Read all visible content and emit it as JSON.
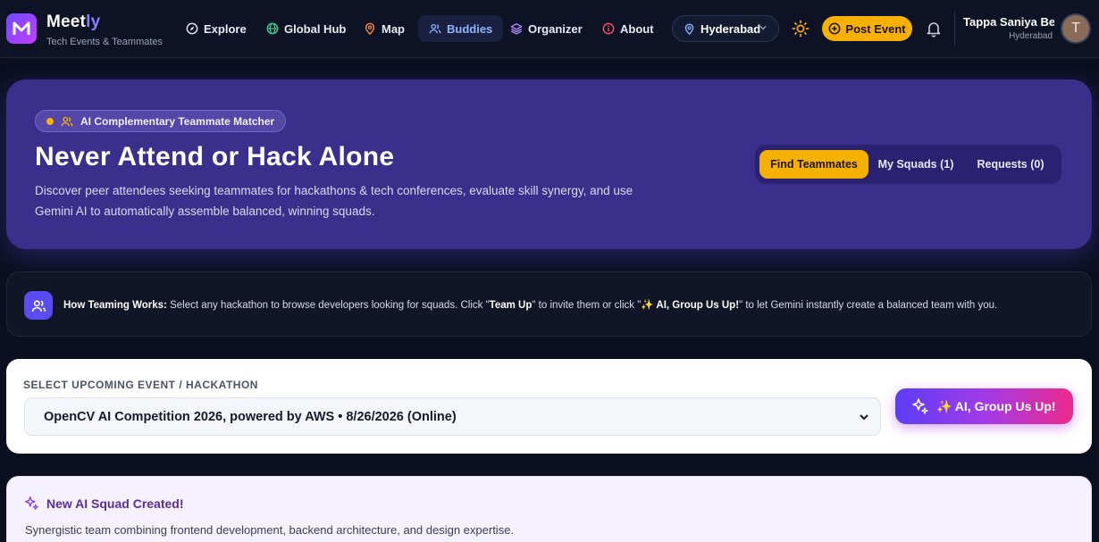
{
  "app": {
    "brand_main": "Meet",
    "brand_accent": "ly",
    "tagline": "Tech Events & Teammates"
  },
  "nav": {
    "items": [
      {
        "label": "Explore",
        "icon": "compass-icon"
      },
      {
        "label": "Global Hub",
        "icon": "globe-icon"
      },
      {
        "label": "Map",
        "icon": "map-pin-icon"
      },
      {
        "label": "Buddies",
        "icon": "users-icon",
        "active": true
      },
      {
        "label": "Organizer",
        "icon": "layers-icon"
      },
      {
        "label": "About",
        "icon": "info-icon"
      }
    ],
    "location": "Hyderabad",
    "post_event_label": "Post Event",
    "user_name": "Tappa Saniya Be...",
    "user_city": "Hyderabad",
    "avatar_initial": "T"
  },
  "hero": {
    "badge": "AI Complementary Teammate Matcher",
    "title": "Never Attend or Hack Alone",
    "description": "Discover peer attendees seeking teammates for hackathons & tech conferences, evaluate skill synergy, and use Gemini AI to automatically assemble balanced, winning squads.",
    "tabs": [
      "Find Teammates",
      "My Squads (1)",
      "Requests (0)"
    ],
    "selected_tab": "Find Teammates"
  },
  "how": {
    "label": "How Teaming Works:",
    "text_1": " Select any hackathon to browse developers looking for squads. Click \"",
    "team_up": "Team Up",
    "text_2": "\" to invite them or click \"",
    "group_label": "✨ AI, Group Us Up!",
    "text_3": "\" to let Gemini instantly create a balanced team with you."
  },
  "select": {
    "label": "SELECT UPCOMING EVENT / HACKATHON",
    "value": "OpenCV AI Competition 2026, powered by AWS • 8/26/2026 (Online)",
    "ai_button": "✨ AI, Group Us Up!"
  },
  "squad": {
    "title": "New AI Squad Created!",
    "description": "Synergistic team combining frontend development, backend architecture, and design expertise."
  },
  "colors": {
    "accent_yellow": "#f6b100",
    "hero_purple": "#3b2f8c",
    "active_nav": "#8fb4ff"
  }
}
